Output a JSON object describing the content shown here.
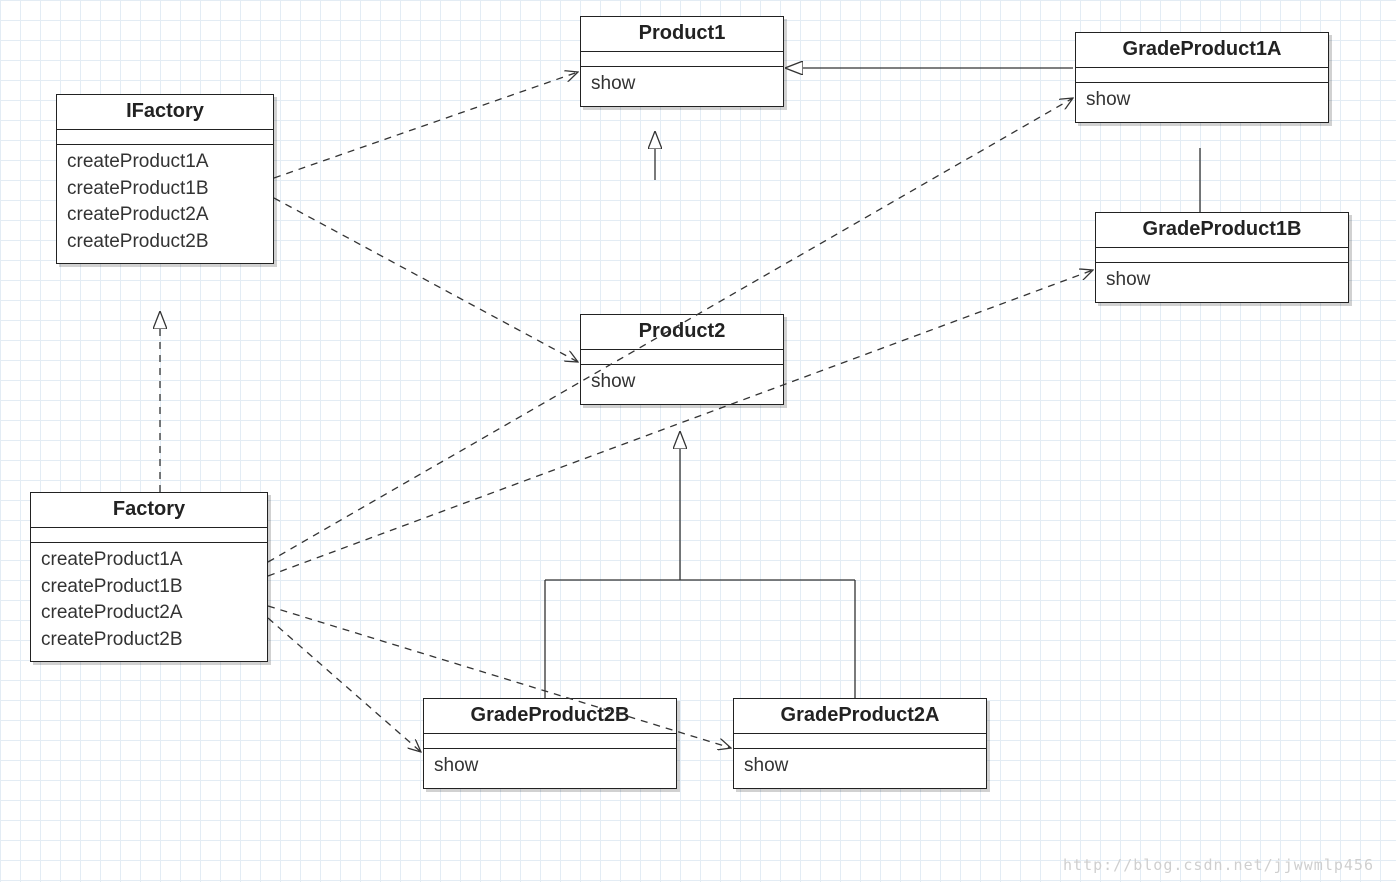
{
  "classes": {
    "ifactory": {
      "title": "IFactory",
      "methods": [
        "createProduct1A",
        "createProduct1B",
        "createProduct2A",
        "createProduct2B"
      ]
    },
    "factory": {
      "title": "Factory",
      "methods": [
        "createProduct1A",
        "createProduct1B",
        "createProduct2A",
        "createProduct2B"
      ]
    },
    "product1": {
      "title": "Product1",
      "methods": [
        "show"
      ]
    },
    "product2": {
      "title": "Product2",
      "methods": [
        "show"
      ]
    },
    "gradeProduct1A": {
      "title": "GradeProduct1A",
      "methods": [
        "show"
      ]
    },
    "gradeProduct1B": {
      "title": "GradeProduct1B",
      "methods": [
        "show"
      ]
    },
    "gradeProduct2A": {
      "title": "GradeProduct2A",
      "methods": [
        "show"
      ]
    },
    "gradeProduct2B": {
      "title": "GradeProduct2B",
      "methods": [
        "show"
      ]
    }
  },
  "watermark": "http://blog.csdn.net/jjwwmlp456"
}
